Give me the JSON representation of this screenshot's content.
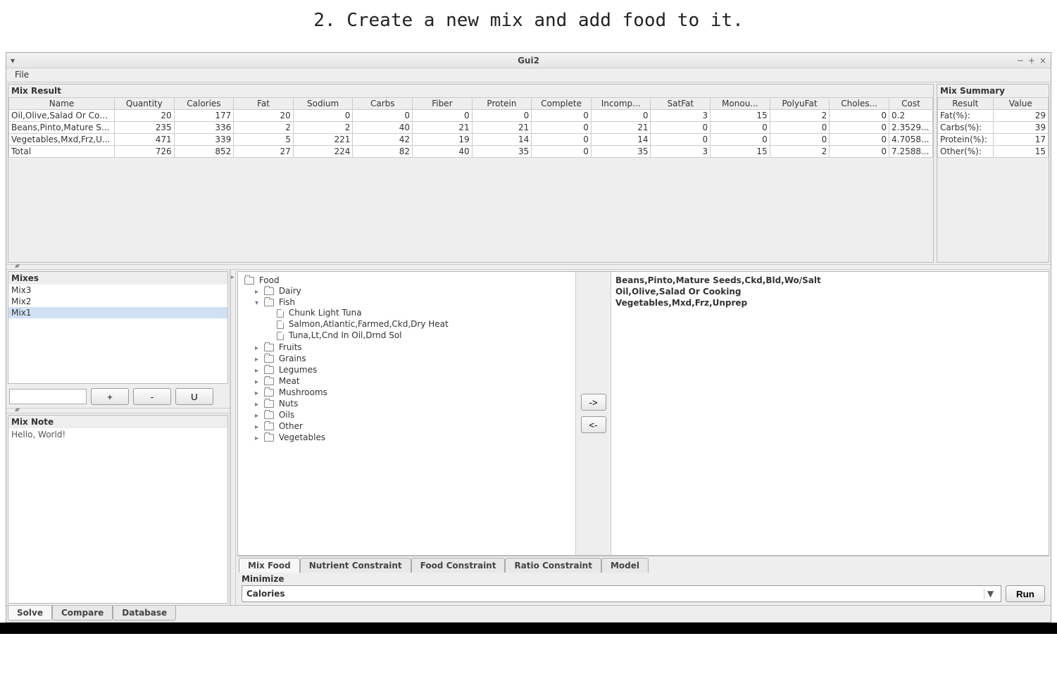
{
  "instruction": "2. Create a new mix and add food to it.",
  "window": {
    "title": "Gui2",
    "menu": {
      "file": "File"
    },
    "controls": {
      "min": "−",
      "max": "+",
      "close": "×"
    }
  },
  "mix_result": {
    "title": "Mix Result",
    "headers": [
      "Name",
      "Quantity",
      "Calories",
      "Fat",
      "Sodium",
      "Carbs",
      "Fiber",
      "Protein",
      "Complete",
      "Incomp...",
      "SatFat",
      "Monou...",
      "PolyuFat",
      "Choles...",
      "Cost"
    ],
    "rows": [
      [
        "Oil,Olive,Salad Or Coo...",
        "20",
        "177",
        "20",
        "0",
        "0",
        "0",
        "0",
        "0",
        "0",
        "3",
        "15",
        "2",
        "0",
        "0.2"
      ],
      [
        "Beans,Pinto,Mature S...",
        "235",
        "336",
        "2",
        "2",
        "40",
        "21",
        "21",
        "0",
        "21",
        "0",
        "0",
        "0",
        "0",
        "2.3529..."
      ],
      [
        "Vegetables,Mxd,Frz,U...",
        "471",
        "339",
        "5",
        "221",
        "42",
        "19",
        "14",
        "0",
        "14",
        "0",
        "0",
        "0",
        "0",
        "4.7058..."
      ],
      [
        "Total",
        "726",
        "852",
        "27",
        "224",
        "82",
        "40",
        "35",
        "0",
        "35",
        "3",
        "15",
        "2",
        "0",
        "7.2588..."
      ]
    ]
  },
  "mix_summary": {
    "title": "Mix Summary",
    "headers": [
      "Result",
      "Value"
    ],
    "rows": [
      [
        "Fat(%):",
        "29"
      ],
      [
        "Carbs(%):",
        "39"
      ],
      [
        "Protein(%):",
        "17"
      ],
      [
        "Other(%):",
        "15"
      ]
    ]
  },
  "mixes": {
    "title": "Mixes",
    "items": [
      "Mix3",
      "Mix2",
      "Mix1"
    ],
    "selected_index": 2,
    "buttons": {
      "add": "+",
      "remove": "-",
      "u": "U"
    }
  },
  "mix_note": {
    "title": "Mix Note",
    "text": "Hello, World!"
  },
  "food_tree": {
    "root": "Food",
    "nodes": [
      {
        "label": "Dairy",
        "expanded": false
      },
      {
        "label": "Fish",
        "expanded": true,
        "children": [
          "Chunk Light Tuna",
          "Salmon,Atlantic,Farmed,Ckd,Dry Heat",
          "Tuna,Lt,Cnd In Oil,Drnd Sol"
        ]
      },
      {
        "label": "Fruits",
        "expanded": false
      },
      {
        "label": "Grains",
        "expanded": false
      },
      {
        "label": "Legumes",
        "expanded": false
      },
      {
        "label": "Meat",
        "expanded": false
      },
      {
        "label": "Mushrooms",
        "expanded": false
      },
      {
        "label": "Nuts",
        "expanded": false
      },
      {
        "label": "Oils",
        "expanded": false
      },
      {
        "label": "Other",
        "expanded": false
      },
      {
        "label": "Vegetables",
        "expanded": false
      }
    ]
  },
  "move": {
    "right": "->",
    "left": "<-"
  },
  "added_foods": [
    "Beans,Pinto,Mature Seeds,Ckd,Bld,Wo/Salt",
    "Oil,Olive,Salad Or Cooking",
    "Vegetables,Mxd,Frz,Unprep"
  ],
  "tabs_mid": {
    "items": [
      "Mix Food",
      "Nutrient Constraint",
      "Food Constraint",
      "Ratio Constraint",
      "Model"
    ],
    "active_index": 0
  },
  "minimize": {
    "label": "Minimize",
    "value": "Calories",
    "run": "Run"
  },
  "tabs_bottom": {
    "items": [
      "Solve",
      "Compare",
      "Database"
    ],
    "active_index": 0
  },
  "chart_data": {
    "type": "table",
    "title": "Mix Result",
    "columns": [
      "Name",
      "Quantity",
      "Calories",
      "Fat",
      "Sodium",
      "Carbs",
      "Fiber",
      "Protein",
      "Complete",
      "Incomp",
      "SatFat",
      "Monou",
      "PolyuFat",
      "Choles",
      "Cost"
    ],
    "rows": [
      {
        "Name": "Oil,Olive,Salad Or Cooking",
        "Quantity": 20,
        "Calories": 177,
        "Fat": 20,
        "Sodium": 0,
        "Carbs": 0,
        "Fiber": 0,
        "Protein": 0,
        "Complete": 0,
        "Incomp": 0,
        "SatFat": 3,
        "Monou": 15,
        "PolyuFat": 2,
        "Choles": 0,
        "Cost": 0.2
      },
      {
        "Name": "Beans,Pinto,Mature Seeds",
        "Quantity": 235,
        "Calories": 336,
        "Fat": 2,
        "Sodium": 2,
        "Carbs": 40,
        "Fiber": 21,
        "Protein": 21,
        "Complete": 0,
        "Incomp": 21,
        "SatFat": 0,
        "Monou": 0,
        "PolyuFat": 0,
        "Choles": 0,
        "Cost": 2.3529
      },
      {
        "Name": "Vegetables,Mxd,Frz,Unprep",
        "Quantity": 471,
        "Calories": 339,
        "Fat": 5,
        "Sodium": 221,
        "Carbs": 42,
        "Fiber": 19,
        "Protein": 14,
        "Complete": 0,
        "Incomp": 14,
        "SatFat": 0,
        "Monou": 0,
        "PolyuFat": 0,
        "Choles": 0,
        "Cost": 4.7058
      },
      {
        "Name": "Total",
        "Quantity": 726,
        "Calories": 852,
        "Fat": 27,
        "Sodium": 224,
        "Carbs": 82,
        "Fiber": 40,
        "Protein": 35,
        "Complete": 0,
        "Incomp": 35,
        "SatFat": 3,
        "Monou": 15,
        "PolyuFat": 2,
        "Choles": 0,
        "Cost": 7.2588
      }
    ]
  }
}
